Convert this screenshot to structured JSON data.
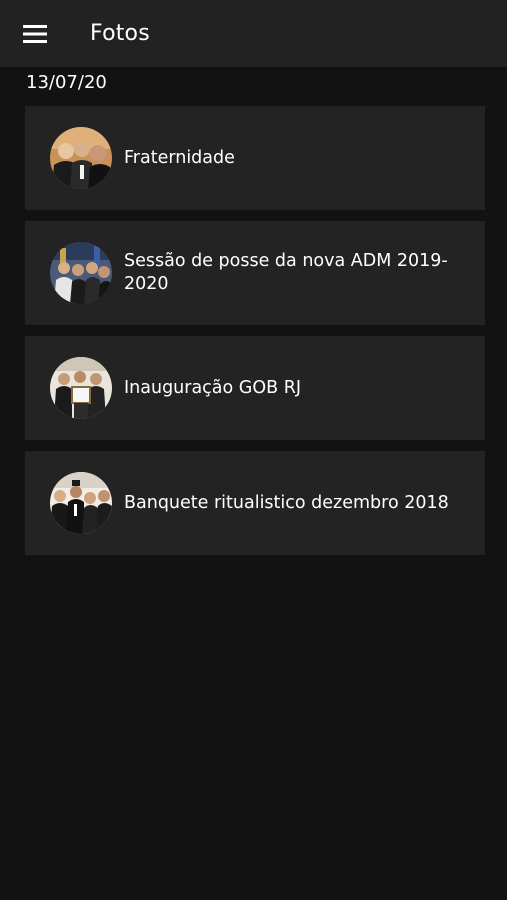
{
  "appbar": {
    "menu_icon": "hamburger-menu-icon",
    "title": "Fotos"
  },
  "date_label": "13/07/20",
  "albums": [
    {
      "label": "Fraternidade",
      "thumb_icon": "group-photo-thumbnail"
    },
    {
      "label": "Sessão de posse da nova ADM 2019-2020",
      "thumb_icon": "group-photo-thumbnail"
    },
    {
      "label": "Inauguração GOB RJ",
      "thumb_icon": "group-photo-thumbnail"
    },
    {
      "label": "Banquete ritualistico dezembro 2018",
      "thumb_icon": "group-photo-thumbnail"
    }
  ],
  "colors": {
    "background": "#121212",
    "appbar": "#222222",
    "card": "#232323",
    "text": "#ffffff"
  }
}
